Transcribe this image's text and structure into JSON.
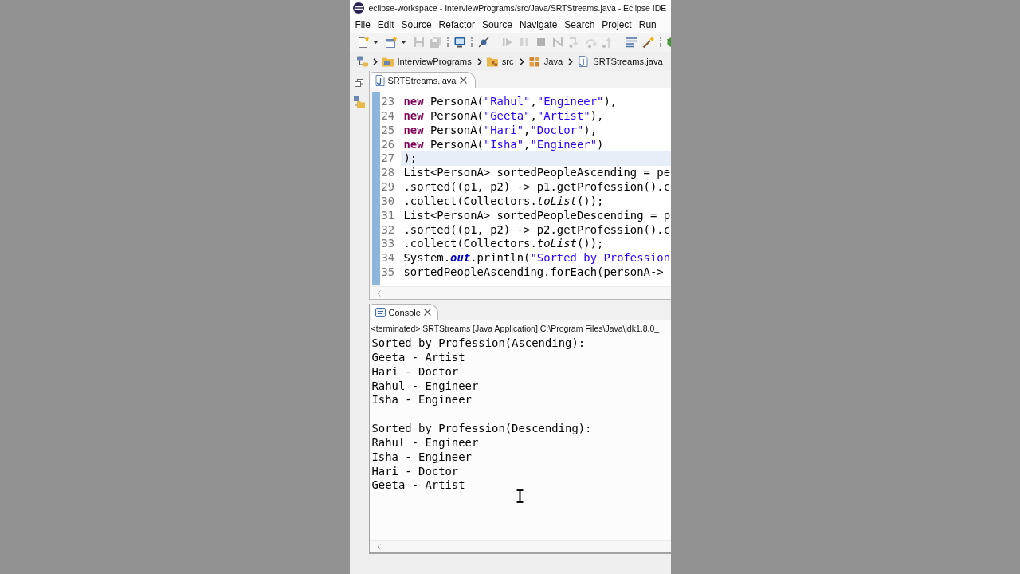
{
  "window": {
    "title": "eclipse-workspace - InterviewPrograms/src/Java/SRTStreams.java - Eclipse IDE"
  },
  "menu": [
    "File",
    "Edit",
    "Source",
    "Refactor",
    "Source",
    "Navigate",
    "Search",
    "Project",
    "Run"
  ],
  "toolbar": [
    {
      "kind": "new",
      "dropdown": true,
      "disabled": false
    },
    {
      "kind": "project",
      "dropdown": true,
      "disabled": false
    },
    {
      "kind": "save",
      "disabled": true
    },
    {
      "kind": "saveall",
      "disabled": true
    },
    {
      "kind": "grip"
    },
    {
      "kind": "monitor",
      "disabled": false
    },
    {
      "kind": "grip"
    },
    {
      "kind": "skip",
      "disabled": false
    },
    {
      "kind": "rule"
    },
    {
      "kind": "resume",
      "disabled": true
    },
    {
      "kind": "suspend",
      "disabled": true
    },
    {
      "kind": "stop",
      "disabled": true
    },
    {
      "kind": "disconnect",
      "disabled": true
    },
    {
      "kind": "stepinto",
      "disabled": true
    },
    {
      "kind": "stepover",
      "disabled": true
    },
    {
      "kind": "stepreturn",
      "disabled": true
    },
    {
      "kind": "rule"
    },
    {
      "kind": "lines",
      "disabled": false
    },
    {
      "kind": "wand",
      "disabled": false
    },
    {
      "kind": "grip"
    },
    {
      "kind": "cube",
      "disabled": false
    }
  ],
  "breadcrumb": [
    {
      "kind": "project",
      "label": "InterviewPrograms"
    },
    {
      "kind": "folder",
      "label": "src"
    },
    {
      "kind": "package",
      "label": "Java"
    },
    {
      "kind": "file",
      "label": "SRTStreams.java"
    }
  ],
  "editor": {
    "tabs": [
      {
        "label": "SRTStreams.java",
        "selected": true
      }
    ],
    "lines": [
      {
        "number": "23",
        "current": false,
        "segments": [
          {
            "kind": "keyword",
            "text": "new"
          },
          {
            "kind": "plain",
            "text": " PersonA("
          },
          {
            "kind": "string",
            "text": "\"Rahul\""
          },
          {
            "kind": "plain",
            "text": ","
          },
          {
            "kind": "string",
            "text": "\"Engineer\""
          },
          {
            "kind": "plain",
            "text": "),"
          }
        ]
      },
      {
        "number": "24",
        "current": false,
        "segments": [
          {
            "kind": "keyword",
            "text": "new"
          },
          {
            "kind": "plain",
            "text": " PersonA("
          },
          {
            "kind": "string",
            "text": "\"Geeta\""
          },
          {
            "kind": "plain",
            "text": ","
          },
          {
            "kind": "string",
            "text": "\"Artist\""
          },
          {
            "kind": "plain",
            "text": "),"
          }
        ]
      },
      {
        "number": "25",
        "current": false,
        "segments": [
          {
            "kind": "keyword",
            "text": "new"
          },
          {
            "kind": "plain",
            "text": " PersonA("
          },
          {
            "kind": "string",
            "text": "\"Hari\""
          },
          {
            "kind": "plain",
            "text": ","
          },
          {
            "kind": "string",
            "text": "\"Doctor\""
          },
          {
            "kind": "plain",
            "text": "),"
          }
        ]
      },
      {
        "number": "26",
        "current": false,
        "segments": [
          {
            "kind": "keyword",
            "text": "new"
          },
          {
            "kind": "plain",
            "text": " PersonA("
          },
          {
            "kind": "string",
            "text": "\"Isha\""
          },
          {
            "kind": "plain",
            "text": ","
          },
          {
            "kind": "string",
            "text": "\"Engineer\""
          },
          {
            "kind": "plain",
            "text": ")"
          }
        ]
      },
      {
        "number": "27",
        "current": true,
        "segments": [
          {
            "kind": "plain",
            "text": ");"
          }
        ]
      },
      {
        "number": "28",
        "current": false,
        "segments": [
          {
            "kind": "plain",
            "text": "List<PersonA> sortedPeopleAscending = pe"
          }
        ]
      },
      {
        "number": "29",
        "current": false,
        "segments": [
          {
            "kind": "plain",
            "text": ".sorted((p1, p2) -> p1.getProfession().c"
          }
        ]
      },
      {
        "number": "30",
        "current": false,
        "segments": [
          {
            "kind": "plain",
            "text": ".collect(Collectors."
          },
          {
            "kind": "static",
            "text": "toList"
          },
          {
            "kind": "plain",
            "text": "());"
          }
        ]
      },
      {
        "number": "31",
        "current": false,
        "segments": [
          {
            "kind": "plain",
            "text": "List<PersonA> sortedPeopleDescending = p"
          }
        ]
      },
      {
        "number": "32",
        "current": false,
        "segments": [
          {
            "kind": "plain",
            "text": ".sorted((p1, p2) -> p2.getProfession().c"
          }
        ]
      },
      {
        "number": "33",
        "current": false,
        "segments": [
          {
            "kind": "plain",
            "text": ".collect(Collectors."
          },
          {
            "kind": "static",
            "text": "toList"
          },
          {
            "kind": "plain",
            "text": "());"
          }
        ]
      },
      {
        "number": "34",
        "current": false,
        "segments": [
          {
            "kind": "plain",
            "text": "System."
          },
          {
            "kind": "field",
            "text": "out"
          },
          {
            "kind": "plain",
            "text": ".println("
          },
          {
            "kind": "string",
            "text": "\"Sorted by Profession"
          }
        ]
      },
      {
        "number": "35",
        "current": false,
        "segments": [
          {
            "kind": "plain",
            "text": "sortedPeopleAscending.forEach(personA->"
          }
        ]
      }
    ]
  },
  "console": {
    "tabs": [
      {
        "label": "Console",
        "selected": true
      }
    ],
    "status": "<terminated> SRTStreams [Java Application] C:\\Program Files\\Java\\jdk1.8.0_",
    "blocks": [
      {
        "lines": [
          "Sorted by Profession(Ascending):",
          "Geeta - Artist",
          "Hari - Doctor",
          "Rahul - Engineer",
          "Isha - Engineer"
        ]
      },
      {
        "lines": [
          "Sorted by Profession(Descending):",
          "Rahul - Engineer",
          "Isha - Engineer",
          "Hari - Doctor",
          "Geeta - Artist"
        ]
      }
    ]
  }
}
